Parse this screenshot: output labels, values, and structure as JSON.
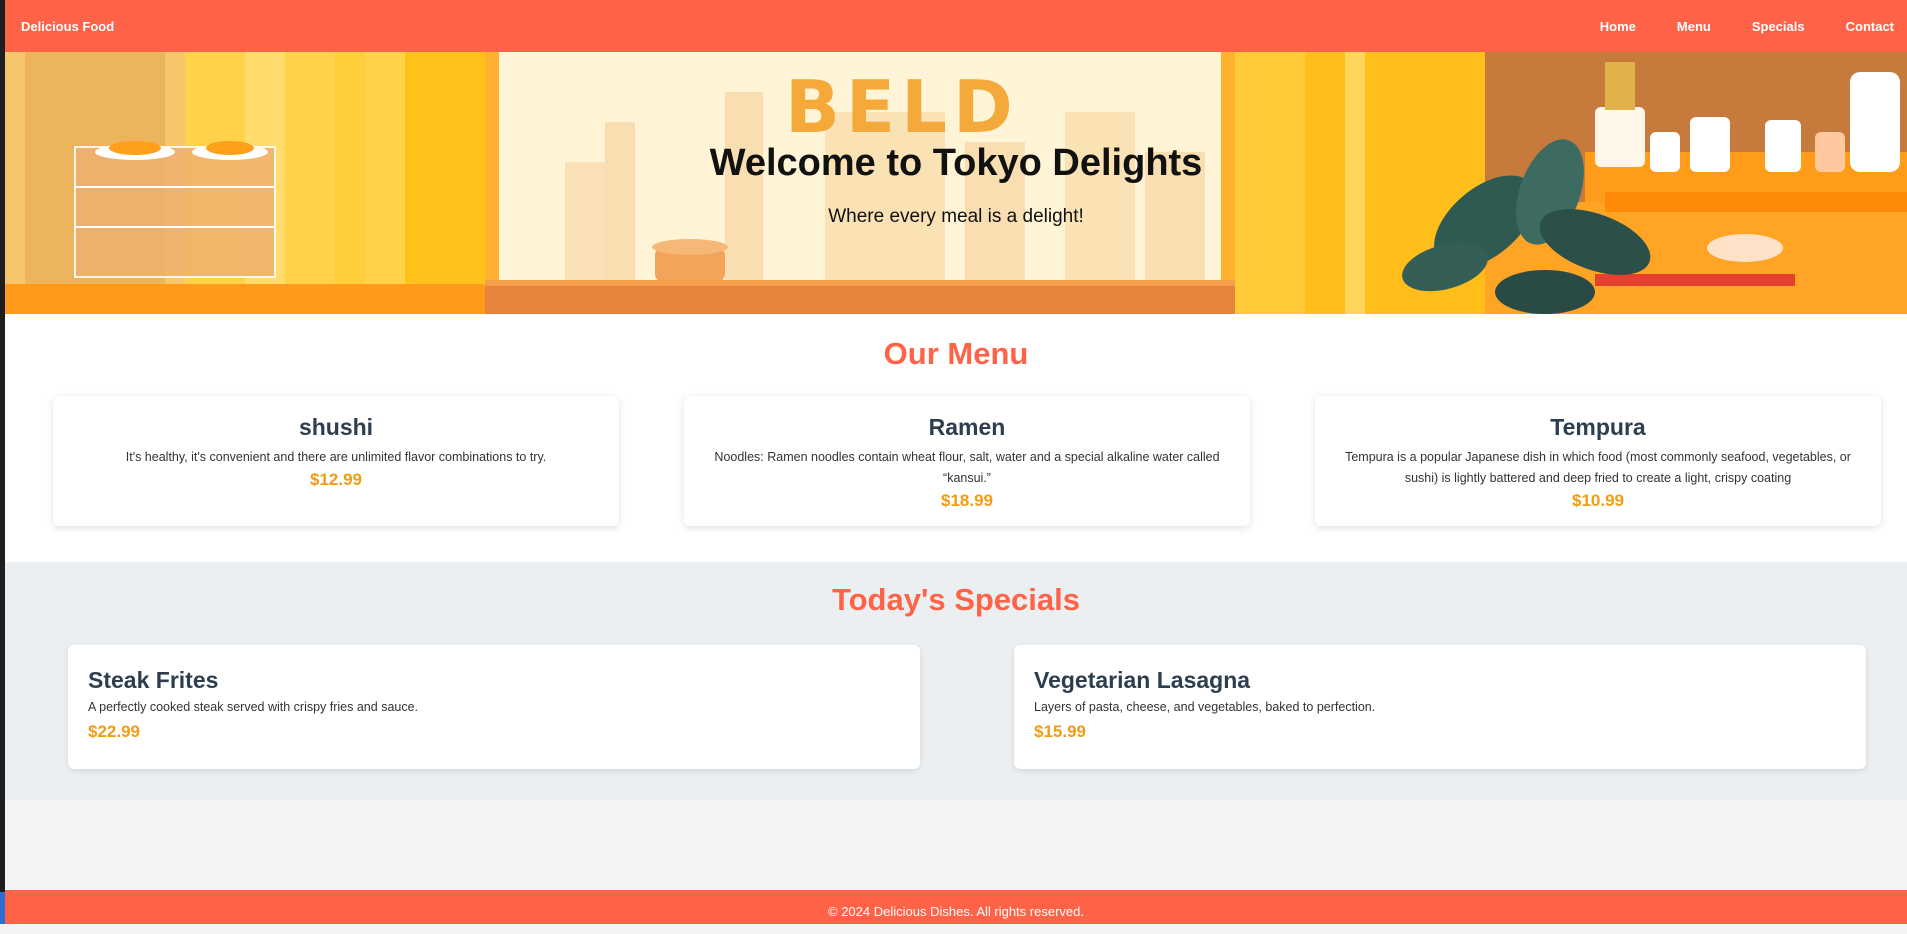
{
  "nav": {
    "brand": "Delicious Food",
    "links": [
      "Home",
      "Menu",
      "Specials",
      "Contact"
    ]
  },
  "hero": {
    "title": "Welcome to Tokyo Delights",
    "subtitle": "Where every meal is a delight!",
    "image_sign_text": "BELD",
    "image_description_colors": {
      "primary": "#ffc107",
      "accent": "#ff8c1a",
      "plant": "#2f4f4a"
    }
  },
  "menu": {
    "title": "Our Menu",
    "items": [
      {
        "name": "shushi",
        "description": "It's healthy, it's convenient and there are unlimited flavor combinations to try.",
        "price": "$12.99"
      },
      {
        "name": "Ramen",
        "description": "Noodles: Ramen noodles contain wheat flour, salt, water and a special alkaline water called “kansui.”",
        "price": "$18.99"
      },
      {
        "name": "Tempura",
        "description": "Tempura is a popular Japanese dish in which food (most commonly seafood, vegetables, or sushi) is lightly battered and deep fried to create a light, crispy coating",
        "price": "$10.99"
      }
    ]
  },
  "specials": {
    "title": "Today's Specials",
    "items": [
      {
        "name": "Steak Frites",
        "description": "A perfectly cooked steak served with crispy fries and sauce.",
        "price": "$22.99"
      },
      {
        "name": "Vegetarian Lasagna",
        "description": "Layers of pasta, cheese, and vegetables, baked to perfection.",
        "price": "$15.99"
      }
    ]
  },
  "footer": {
    "text": "© 2024 Delicious Dishes. All rights reserved."
  },
  "colors": {
    "brand": "#ff6347",
    "price": "#f39c12",
    "heading": "#2c3e50",
    "specials_bg": "#ebeff1"
  }
}
